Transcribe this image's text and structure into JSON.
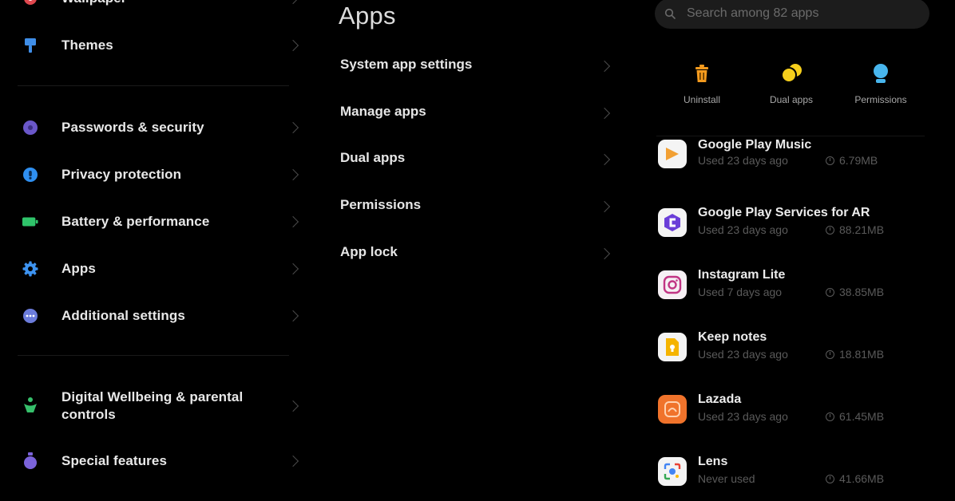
{
  "settings": {
    "items": [
      {
        "label": "Wallpaper",
        "icon": "wallpaper-icon",
        "color": "#e0484f"
      },
      {
        "label": "Themes",
        "icon": "themes-icon",
        "color": "#3f8ee8"
      },
      {
        "label": "Passwords & security",
        "icon": "passwords-security-icon",
        "color": "#6a57c9"
      },
      {
        "label": "Privacy protection",
        "icon": "privacy-protection-icon",
        "color": "#2f8ff0"
      },
      {
        "label": "Battery & performance",
        "icon": "battery-icon",
        "color": "#2fc46a"
      },
      {
        "label": "Apps",
        "icon": "gear-icon",
        "color": "#3d93f0"
      },
      {
        "label": "Additional settings",
        "icon": "more-icon",
        "color": "#6b7cdb"
      },
      {
        "label": "Digital Wellbeing & parental controls",
        "icon": "wellbeing-icon",
        "color": "#36c06b"
      },
      {
        "label": "Special features",
        "icon": "special-features-icon",
        "color": "#7b63db"
      }
    ]
  },
  "apps_panel": {
    "title": "Apps",
    "items": [
      {
        "label": "System app settings"
      },
      {
        "label": "Manage apps"
      },
      {
        "label": "Dual apps"
      },
      {
        "label": "Permissions"
      },
      {
        "label": "App lock"
      }
    ]
  },
  "search": {
    "placeholder": "Search among 82 apps"
  },
  "quick_actions": [
    {
      "label": "Uninstall",
      "icon": "trash-icon",
      "color": "#f39a1e"
    },
    {
      "label": "Dual apps",
      "icon": "dual-apps-icon",
      "color": "#f6cf1c"
    },
    {
      "label": "Permissions",
      "icon": "permissions-icon",
      "color": "#48b6ee"
    }
  ],
  "app_list": [
    {
      "name": "Google Play Music",
      "used": "Used 23 days ago",
      "size": "6.79MB",
      "icon": "play-music-icon",
      "color": "#f2a033"
    },
    {
      "name": "Google Play Services for AR",
      "used": "Used 23 days ago",
      "size": "88.21MB",
      "icon": "ar-services-icon",
      "color": "#6a3ed8"
    },
    {
      "name": "Instagram Lite",
      "used": "Used 7 days ago",
      "size": "38.85MB",
      "icon": "instagram-icon",
      "color": "#c13584"
    },
    {
      "name": "Keep notes",
      "used": "Used 23 days ago",
      "size": "18.81MB",
      "icon": "keep-notes-icon",
      "color": "#f5b400"
    },
    {
      "name": "Lazada",
      "used": "Used 23 days ago",
      "size": "61.45MB",
      "icon": "lazada-icon",
      "color": "#f0732b"
    },
    {
      "name": "Lens",
      "used": "Never used",
      "size": "41.66MB",
      "icon": "lens-icon",
      "color": "#4285f4"
    }
  ]
}
